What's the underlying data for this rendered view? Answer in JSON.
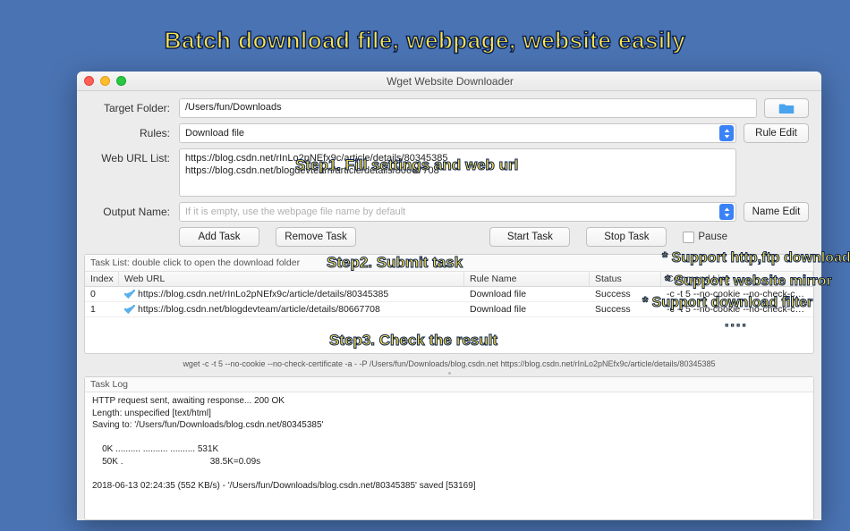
{
  "promo": {
    "title": "Batch download file, webpage, website easily",
    "step1": "Step1. Fill settings and web url",
    "step2": "Step2. Submit task",
    "step3": "Step3. Check the result",
    "feat1": "* Support http,ftp download",
    "feat2": "* Support website mirror",
    "feat3": "* Support download filter",
    "feat4": "...."
  },
  "window": {
    "title": "Wget Website Downloader"
  },
  "form": {
    "target_folder_label": "Target Folder:",
    "target_folder_value": "/Users/fun/Downloads",
    "rules_label": "Rules:",
    "rules_value": "Download file",
    "rule_edit": "Rule Edit",
    "web_url_list_label": "Web URL List:",
    "web_url_list_value": "https://blog.csdn.net/rInLo2pNEfx9c/article/details/80345385\nhttps://blog.csdn.net/blogdevteam/article/details/80667708",
    "output_name_label": "Output Name:",
    "output_name_placeholder": "If it is empty, use the webpage  file name by default",
    "name_edit": "Name Edit",
    "add_task": "Add Task",
    "remove_task": "Remove Task",
    "start_task": "Start Task",
    "stop_task": "Stop Task",
    "pause_label": "Pause"
  },
  "table": {
    "caption": "Task List: double click to open the download folder",
    "headers": {
      "index": "Index",
      "url": "Web URL",
      "rule": "Rule Name",
      "status": "Status",
      "cmd": "Command Line"
    },
    "rows": [
      {
        "index": "0",
        "url": "https://blog.csdn.net/rInLo2pNEfx9c/article/details/80345385",
        "rule": "Download file",
        "status": "Success",
        "cmd": "-c -t 5 --no-cookie --no-check-ce..."
      },
      {
        "index": "1",
        "url": "https://blog.csdn.net/blogdevteam/article/details/80667708",
        "rule": "Download file",
        "status": "Success",
        "cmd": "-c -t 5 --no-cookie --no-check-ce..."
      }
    ]
  },
  "wget_line": "wget -c -t 5 --no-cookie --no-check-certificate -a - -P /Users/fun/Downloads/blog.csdn.net https://blog.csdn.net/rInLo2pNEfx9c/article/details/80345385",
  "log": {
    "caption": "Task Log",
    "body": "HTTP request sent, awaiting response... 200 OK\nLength: unspecified [text/html]\nSaving to: '/Users/fun/Downloads/blog.csdn.net/80345385'\n\n    0K .......... .......... .......... 531K\n    50K .                                   38.5K=0.09s\n\n2018-06-13 02:24:35 (552 KB/s) - '/Users/fun/Downloads/blog.csdn.net/80345385' saved [53169]"
  }
}
